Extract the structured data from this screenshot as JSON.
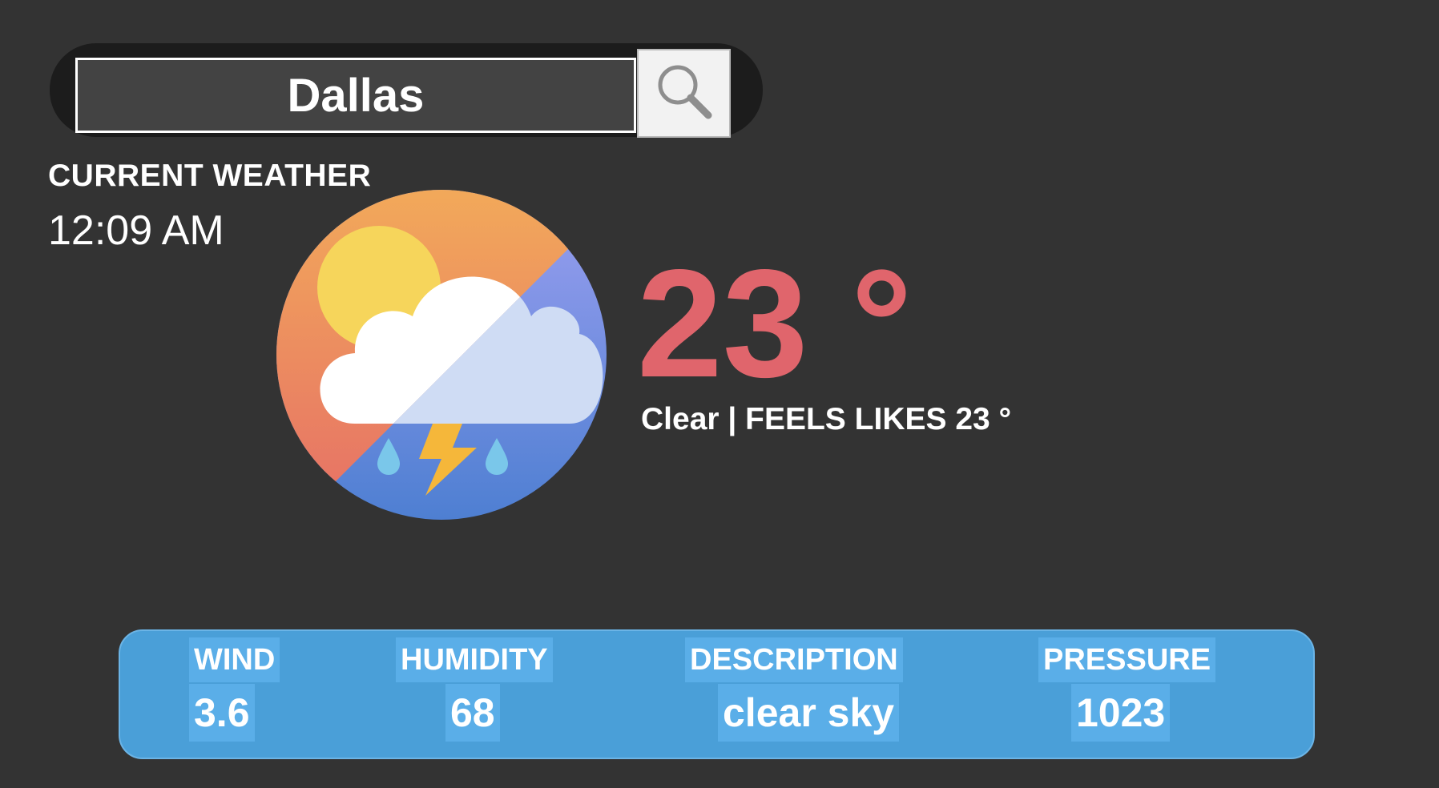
{
  "search": {
    "value": "Dallas",
    "icon": "search-icon"
  },
  "current": {
    "label": "CURRENT WEATHER",
    "time": "12:09 AM"
  },
  "weather_icon": "cloud-sun-thunderstorm-icon",
  "temperature": {
    "value": "23 °",
    "summary": "Clear | FEELS LIKES 23 °"
  },
  "stats": {
    "wind": {
      "label": "WIND",
      "value": "3.6"
    },
    "humidity": {
      "label": "HUMIDITY",
      "value": "68"
    },
    "description": {
      "label": "DESCRIPTION",
      "value": "clear sky"
    },
    "pressure": {
      "label": "PRESSURE",
      "value": "1023"
    }
  },
  "colors": {
    "background": "#333333",
    "temperature": "#e0656c",
    "panel": "#4a9fd8",
    "panel_highlight": "#5aaee8"
  }
}
